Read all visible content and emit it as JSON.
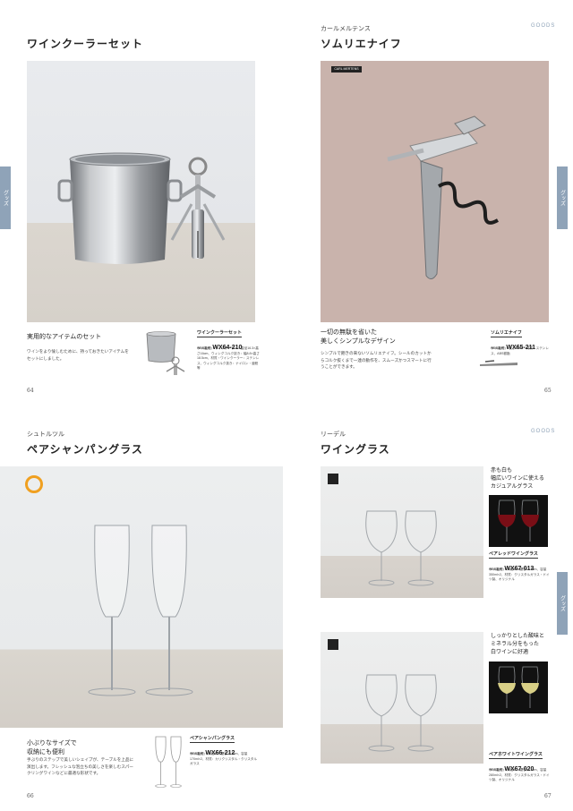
{
  "goods_label": "GOODS",
  "tab_label": "グッズ",
  "p64": {
    "title": "ワインクーラーセット",
    "catch": "実用的なアイテムのセット",
    "desc": "ワインをより愉しむために、持っておきたいアイテムをセットにしました。",
    "product_name": "ワインクーラーセット",
    "code_label": "WEB番号",
    "code": "WX64-210",
    "spec": "サイズ(約)・ワインクーラー：直径16.3×高さ16cm、ウィングコルク抜き：幅8.8×高さ18.5cm、材質・ワインクーラー：ステンレス、ウィングコルク抜き：ナイロン・亜鉛等",
    "page_no": "64"
  },
  "p65": {
    "brand": "カールメルテンス",
    "title": "ソムリエナイフ",
    "logo": "CARL MERTENS",
    "catch": "一切の無駄を省いた\n美しくシンプルなデザイン",
    "desc": "シンプルで飽きの来ないソムリエナイフ。シールのカットからコルク抜くまで一連の動作を、スムーズかつスマートに行うことができます。",
    "product_name": "ソムリエナイフ",
    "code_label": "WEB番号",
    "code": "WX65-211",
    "spec": "サイズ(約)・長さ12cm・材質：ステンレス、ABS樹脂",
    "page_no": "65"
  },
  "p66": {
    "brand": "シュトルツル",
    "title": "ペアシャンパングラス",
    "catch": "小ぶりなサイズで\n収納にも便利",
    "desc": "手ぶりのステップで美しいシェイプが、テーブルを上品に演出します。フレッシュな泡立ちの美しさを楽しむスパークリングワインなどに最適な形状です。",
    "product_name": "ペアシャンパングラス",
    "code_label": "WEB番号",
    "code": "WX66-212",
    "spec": "サイズ(約)・口径4.5×高さ22.5cm、容量170ml×2、材質：カリクリスタル・クリスタルガラス",
    "page_no": "66"
  },
  "p67": {
    "brand": "リーデル",
    "title": "ワイングラス",
    "items": [
      {
        "catch": "赤も白も\n幅広いワインに使える\nカジュアルグラス",
        "product_name": "ペアレッドワイングラス",
        "code_label": "WEB番号",
        "code": "WX67-013",
        "spec": "サイズ(約)・口径8.9×高さ19.5cm、容量350ml×2、材質：クリスタルガラス・ドイツ製、オリジナル"
      },
      {
        "catch": "しっかりとした酸味と\nミネラル分をもった\n白ワインに好適",
        "product_name": "ペアホワイトワイングラス",
        "code_label": "WEB番号",
        "code": "WX67-020",
        "spec": "サイズ(約)・口径8.1×高さ19.5cm、容量280ml×2、材質：クリスタルガラス・ドイツ製、オリジナル"
      }
    ],
    "page_no": "67"
  }
}
